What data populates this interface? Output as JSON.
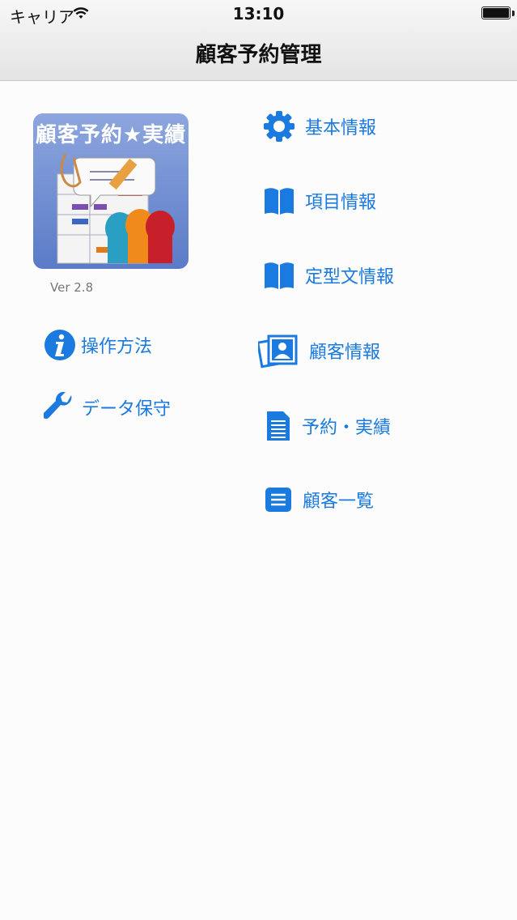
{
  "status_bar": {
    "carrier": "キャリア",
    "time": "13:10"
  },
  "header": {
    "title": "顧客予約管理"
  },
  "app": {
    "icon_text": "顧客予約★実績",
    "version": "Ver 2.8"
  },
  "left_menu": [
    {
      "label": "操作方法",
      "icon": "info-icon"
    },
    {
      "label": "データ保守",
      "icon": "wrench-icon"
    }
  ],
  "right_menu": [
    {
      "label": "基本情報",
      "icon": "gear-icon"
    },
    {
      "label": "項目情報",
      "icon": "book-icon"
    },
    {
      "label": "定型文情報",
      "icon": "book-icon"
    },
    {
      "label": "顧客情報",
      "icon": "contact-photo-icon"
    },
    {
      "label": "予約・実績",
      "icon": "document-icon"
    },
    {
      "label": "顧客一覧",
      "icon": "list-icon"
    }
  ],
  "colors": {
    "accent": "#1a7ae0",
    "nav_bg": "#efefef"
  }
}
